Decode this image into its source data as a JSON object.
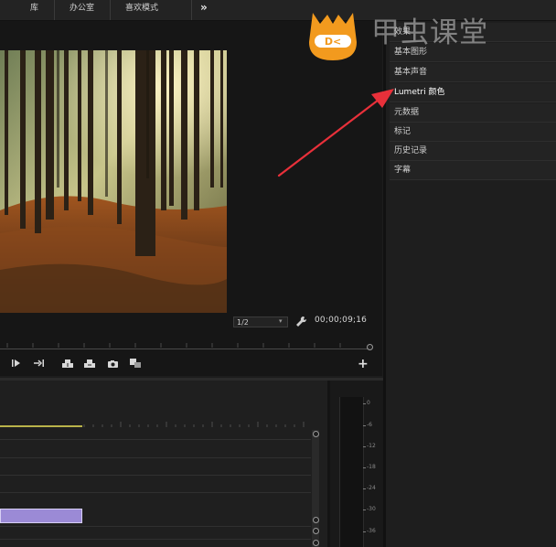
{
  "workspace_tabs": [
    "库",
    "办公室",
    "喜欢模式"
  ],
  "more_label": "»",
  "monitor": {
    "zoom": "1/2",
    "timecode": "00;00;09;16"
  },
  "transport_buttons": [
    "step-forward-icon",
    "go-to-out-icon",
    "insert-icon",
    "overwrite-icon",
    "camera-icon",
    "compare-icon"
  ],
  "add_button": "+",
  "menu": [
    {
      "label": "效果",
      "active": false
    },
    {
      "label": "基本图形",
      "active": false
    },
    {
      "label": "基本声音",
      "active": false
    },
    {
      "label": "Lumetri 颜色",
      "active": true
    },
    {
      "label": "元数据",
      "active": false
    },
    {
      "label": "标记",
      "active": false
    },
    {
      "label": "历史记录",
      "active": false
    },
    {
      "label": "字幕",
      "active": false
    }
  ],
  "meter_labels": [
    "0",
    "-6",
    "-12",
    "-18",
    "-24",
    "-30",
    "-36"
  ],
  "watermark": {
    "text": "甲虫课堂",
    "logo_text": "D<"
  },
  "colors": {
    "accent_clip": "#9b8ad6",
    "playbar": "#b9b34a",
    "arrow": "#e8303a",
    "logo": "#f29a1e"
  }
}
